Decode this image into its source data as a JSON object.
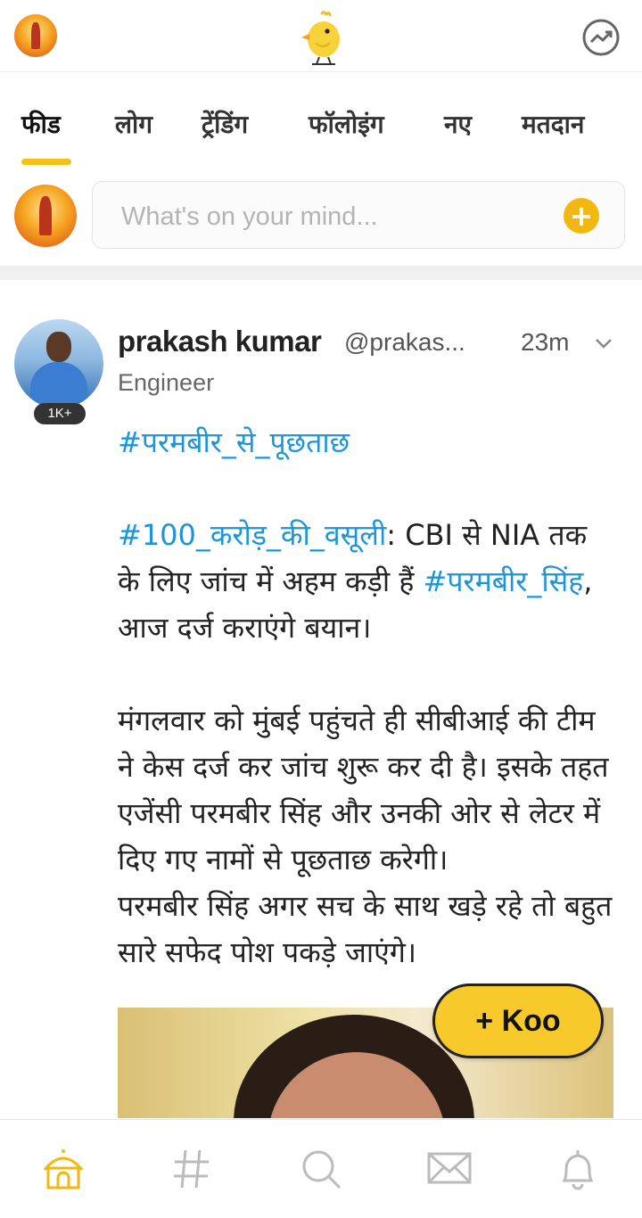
{
  "topbar": {
    "logo_icon": "koo-bird-logo",
    "trending_icon": "trending-up-icon"
  },
  "tabs": [
    {
      "label": "फीड",
      "active": true
    },
    {
      "label": "लोग",
      "active": false
    },
    {
      "label": "ट्रेंडिंग",
      "active": false
    },
    {
      "label": "फॉलोइंग",
      "active": false
    },
    {
      "label": "नए",
      "active": false
    },
    {
      "label": "मतदान",
      "active": false
    }
  ],
  "composer": {
    "placeholder": "What's on your mind...",
    "add_icon": "plus-icon"
  },
  "post": {
    "author_name": "prakash kumar",
    "handle": "@prakas...",
    "time": "23m",
    "title": "Engineer",
    "follower_badge": "1K+",
    "hashtag1": "#परमबीर_से_पूछताछ",
    "hashtag2": "#100_करोड़_की_वसूली",
    "text1": ": CBI से NIA तक के लिए जांच में अहम कड़ी हैं ",
    "hashtag3": "#परमबीर_सिंह",
    "text2": ", आज दर्ज कराएंगे बयान।",
    "para2": "मंगलवार को मुंबई पहुंचते ही सीबीआई की टीम ने केस दर्ज कर जांच शुरू कर दी है। इसके तहत एजेंसी परमबीर सिंह और उनकी ओर से लेटर में दिए गए नामों से पूछताछ करेगी।",
    "para3": "परमबीर सिंह अगर सच के साथ खड़े रहे तो बहुत सारे सफेद पोश पकड़े जाएंगे।"
  },
  "koo_button": "+ Koo",
  "bottom_nav": [
    {
      "icon": "home-icon",
      "active": true
    },
    {
      "icon": "hashtag-icon",
      "active": false
    },
    {
      "icon": "search-icon",
      "active": false
    },
    {
      "icon": "mail-icon",
      "active": false
    },
    {
      "icon": "bell-icon",
      "active": false
    }
  ],
  "colors": {
    "accent": "#f2c21b",
    "hashtag": "#1f94d6"
  }
}
